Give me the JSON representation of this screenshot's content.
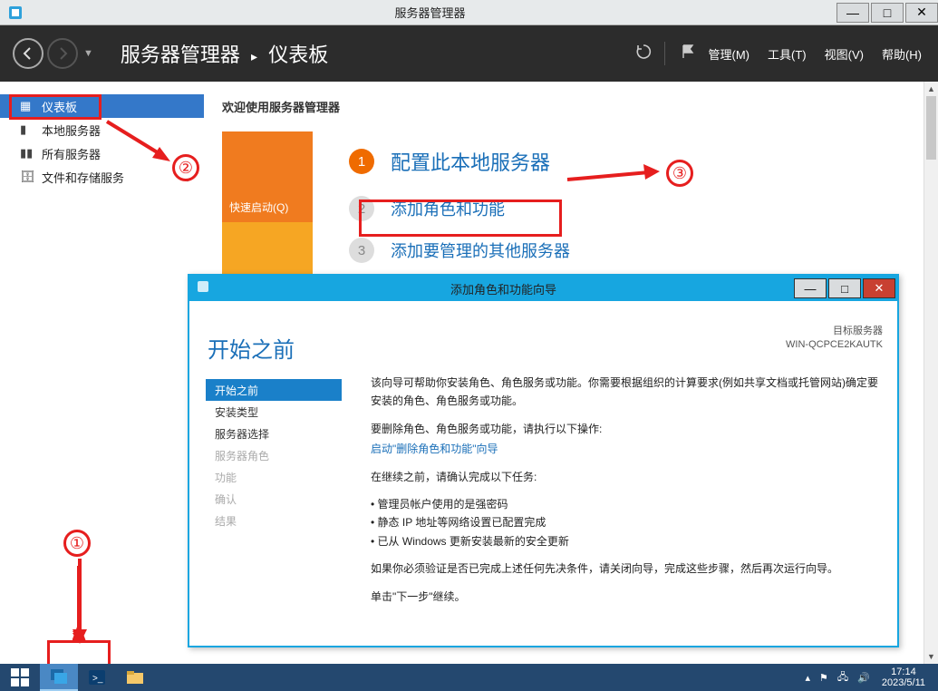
{
  "outer_window": {
    "title": "服务器管理器",
    "buttons": {
      "min": "—",
      "max": "□",
      "close": "✕"
    }
  },
  "header": {
    "breadcrumb_root": "服务器管理器",
    "breadcrumb_sep": "•",
    "breadcrumb_current": "仪表板",
    "menus": {
      "manage": "管理(M)",
      "tools": "工具(T)",
      "view": "视图(V)",
      "help": "帮助(H)"
    }
  },
  "sidebar": {
    "items": [
      {
        "icon": "▦",
        "label": "仪表板",
        "active": true
      },
      {
        "icon": "▮",
        "label": "本地服务器"
      },
      {
        "icon": "▮▮",
        "label": "所有服务器"
      },
      {
        "icon": "🗄",
        "label": "文件和存储服务",
        "expandable": true
      }
    ]
  },
  "main": {
    "welcome": "欢迎使用服务器管理器",
    "quick_start_label": "快速启动(Q)",
    "steps": [
      {
        "num": "1",
        "label": "配置此本地服务器"
      },
      {
        "num": "2",
        "label": "添加角色和功能"
      },
      {
        "num": "3",
        "label": "添加要管理的其他服务器"
      }
    ]
  },
  "annotations": {
    "c1": "①",
    "c2": "②",
    "c3": "③"
  },
  "wizard": {
    "title": "添加角色和功能向导",
    "heading": "开始之前",
    "target_label": "目标服务器",
    "target_server": "WIN-QCPCE2KAUTK",
    "nav": [
      {
        "label": "开始之前",
        "sel": true
      },
      {
        "label": "安装类型"
      },
      {
        "label": "服务器选择"
      },
      {
        "label": "服务器角色",
        "disabled": true
      },
      {
        "label": "功能",
        "disabled": true
      },
      {
        "label": "确认",
        "disabled": true
      },
      {
        "label": "结果",
        "disabled": true
      }
    ],
    "body": {
      "p1": "该向导可帮助你安装角色、角色服务或功能。你需要根据组织的计算要求(例如共享文档或托管网站)确定要安装的角色、角色服务或功能。",
      "p2": "要删除角色、角色服务或功能，请执行以下操作:",
      "link": "启动\"删除角色和功能\"向导",
      "p3": "在继续之前，请确认完成以下任务:",
      "bullets": [
        "管理员帐户使用的是强密码",
        "静态 IP 地址等网络设置已配置完成",
        "已从 Windows 更新安装最新的安全更新"
      ],
      "p4": "如果你必须验证是否已完成上述任何先决条件，请关闭向导，完成这些步骤，然后再次运行向导。",
      "p5": "单击\"下一步\"继续。"
    },
    "buttons": {
      "min": "—",
      "max": "□",
      "close": "✕"
    }
  },
  "taskbar": {
    "time": "17:14",
    "date": "2023/5/11"
  }
}
